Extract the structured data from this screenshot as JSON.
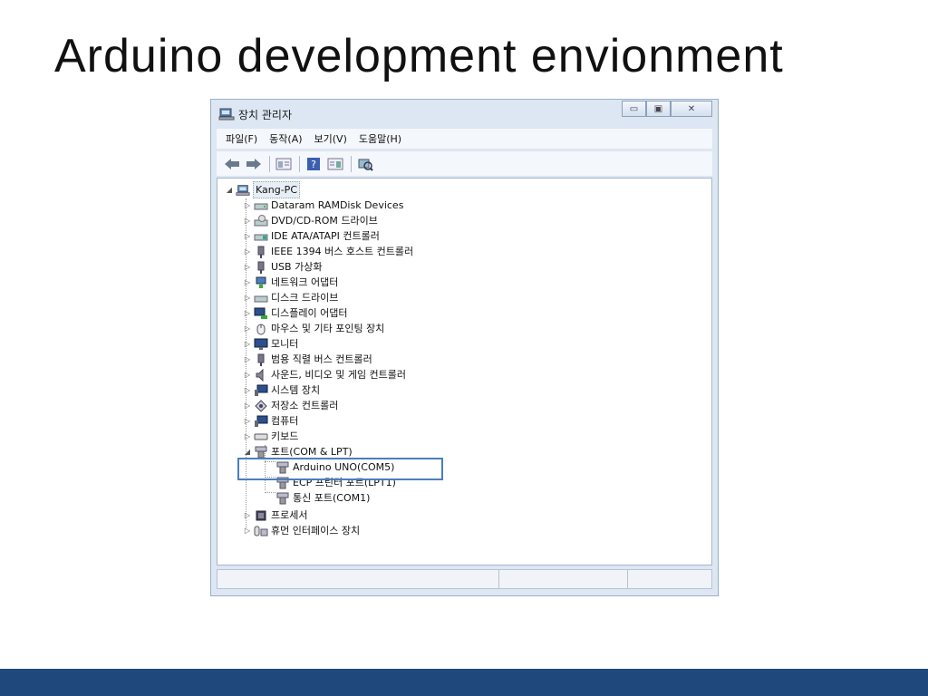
{
  "slide": {
    "title": "Arduino development envionment"
  },
  "window": {
    "title": "장치 관리자",
    "minimize_glyph": "▭",
    "maximize_glyph": "▣",
    "close_glyph": "✕"
  },
  "menu": {
    "items": [
      "파일(F)",
      "동작(A)",
      "보기(V)",
      "도움말(H)"
    ]
  },
  "toolbar": {
    "icons": [
      "back-arrow-icon",
      "forward-arrow-icon",
      "properties-icon",
      "help-icon",
      "view-icon",
      "scan-hardware-icon"
    ]
  },
  "tree": {
    "root": {
      "label": "Kang-PC",
      "expanded": true,
      "icon": "computer-icon"
    },
    "categories": [
      {
        "label": "Dataram RAMDisk Devices",
        "icon": "drive-icon",
        "expanded": false
      },
      {
        "label": "DVD/CD-ROM 드라이브",
        "icon": "dvd-icon",
        "expanded": false
      },
      {
        "label": "IDE ATA/ATAPI 컨트롤러",
        "icon": "ide-icon",
        "expanded": false
      },
      {
        "label": "IEEE 1394 버스 호스트 컨트롤러",
        "icon": "plug-icon",
        "expanded": false
      },
      {
        "label": "USB 가상화",
        "icon": "usb-icon",
        "expanded": false
      },
      {
        "label": "네트워크 어댑터",
        "icon": "network-icon",
        "expanded": false
      },
      {
        "label": "디스크 드라이브",
        "icon": "disk-icon",
        "expanded": false
      },
      {
        "label": "디스플레이 어댑터",
        "icon": "display-icon",
        "expanded": false
      },
      {
        "label": "마우스 및 기타 포인팅 장치",
        "icon": "mouse-icon",
        "expanded": false
      },
      {
        "label": "모니터",
        "icon": "monitor-icon",
        "expanded": false
      },
      {
        "label": "범용 직렬 버스 컨트롤러",
        "icon": "usb-controller-icon",
        "expanded": false
      },
      {
        "label": "사운드, 비디오 및 게임 컨트롤러",
        "icon": "speaker-icon",
        "expanded": false
      },
      {
        "label": "시스템 장치",
        "icon": "system-icon",
        "expanded": false
      },
      {
        "label": "저장소 컨트롤러",
        "icon": "storage-icon",
        "expanded": false
      },
      {
        "label": "컴퓨터",
        "icon": "computer-small-icon",
        "expanded": false
      },
      {
        "label": "키보드",
        "icon": "keyboard-icon",
        "expanded": false
      },
      {
        "label": "포트(COM & LPT)",
        "icon": "port-icon",
        "expanded": true
      }
    ],
    "ports_children": [
      {
        "label": "Arduino UNO(COM5)",
        "icon": "port-icon",
        "highlighted": true
      },
      {
        "label": "ECP 프린터 포트(LPT1)",
        "icon": "port-icon",
        "highlighted": false
      },
      {
        "label": "통신 포트(COM1)",
        "icon": "port-icon",
        "highlighted": false
      }
    ],
    "after_ports": [
      {
        "label": "프로세서",
        "icon": "processor-icon",
        "expanded": false
      },
      {
        "label": "휴먼 인터페이스 장치",
        "icon": "hid-icon",
        "expanded": false
      }
    ]
  },
  "colors": {
    "footer": "#1f497d",
    "highlight": "#4a7ec0",
    "window_frame": "#dce7f3"
  }
}
